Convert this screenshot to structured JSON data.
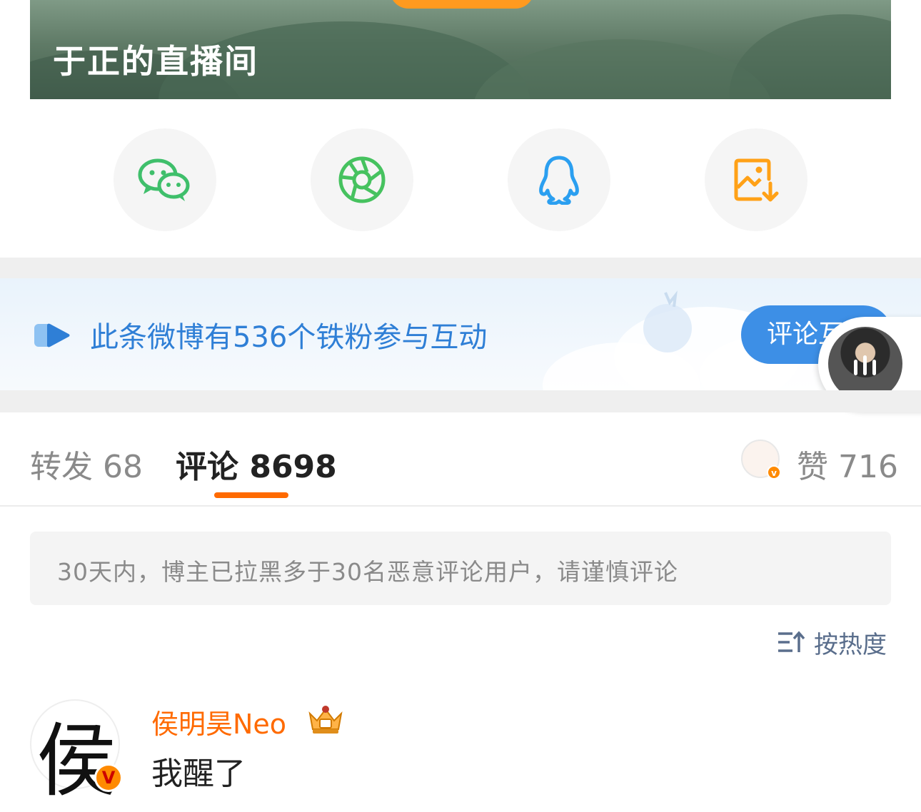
{
  "live": {
    "title": "于正的直播间"
  },
  "share": {
    "items": [
      {
        "icon": "wechat-icon",
        "color": "#3fbf6b"
      },
      {
        "icon": "moments-icon",
        "color": "#46c25f"
      },
      {
        "icon": "qq-icon",
        "color": "#2b9ff0"
      },
      {
        "icon": "save-image-icon",
        "color": "#ffa117"
      }
    ]
  },
  "fan_banner": {
    "text": "此条微博有536个铁粉参与互动",
    "button_label": "评论互"
  },
  "tabs": {
    "forward_label": "转发",
    "forward_count": "68",
    "comment_label": "评论",
    "comment_count": "8698",
    "like_label": "赞",
    "like_count": "716",
    "active": "comment"
  },
  "notice": {
    "text": "30天内，博主已拉黑多于30名恶意评论用户，请谨慎评论"
  },
  "sort": {
    "label": "按热度"
  },
  "comments": [
    {
      "avatar_glyph": "侯",
      "badge": "V",
      "name": "侯明昊Neo",
      "text": "我醒了"
    }
  ],
  "colors": {
    "accent": "#ff6a00",
    "link_blue": "#2f7fd6",
    "button_blue": "#3d8fe6"
  }
}
